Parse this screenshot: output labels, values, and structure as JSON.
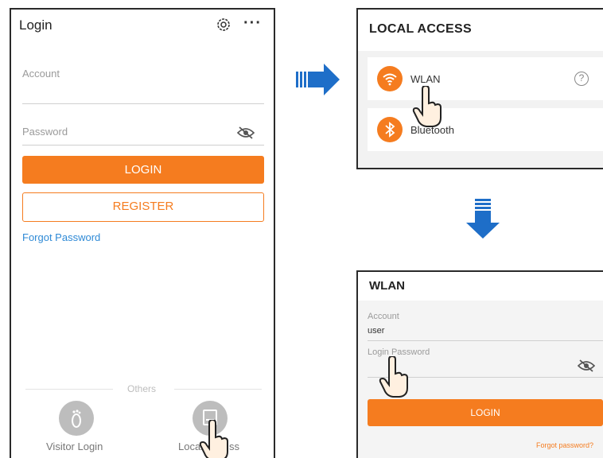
{
  "login_screen": {
    "title": "Login",
    "settings_icon": "gear-icon",
    "more_icon": "more-dots-icon",
    "account_placeholder": "Account",
    "password_placeholder": "Password",
    "login_button": "LOGIN",
    "register_button": "REGISTER",
    "forgot_password": "Forgot Password",
    "others_label": "Others",
    "visitor_login": "Visitor Login",
    "local_access": "Local Access",
    "local_access_visible_left": "Local",
    "local_access_visible_right": "ss"
  },
  "local_access_screen": {
    "title": "LOCAL ACCESS",
    "items": [
      {
        "label": "WLAN",
        "icon": "wifi-icon"
      },
      {
        "label": "Bluetooth",
        "icon": "bluetooth-icon"
      }
    ],
    "help_icon": "?"
  },
  "wlan_screen": {
    "title": "WLAN",
    "account_label": "Account",
    "account_value": "user",
    "password_label": "Login Password",
    "login_button": "LOGIN",
    "forgot_password": "Forgot password?"
  },
  "colors": {
    "accent_orange": "#f57c1f",
    "link_blue": "#2f8ad6",
    "arrow_blue": "#1e6ec8"
  }
}
